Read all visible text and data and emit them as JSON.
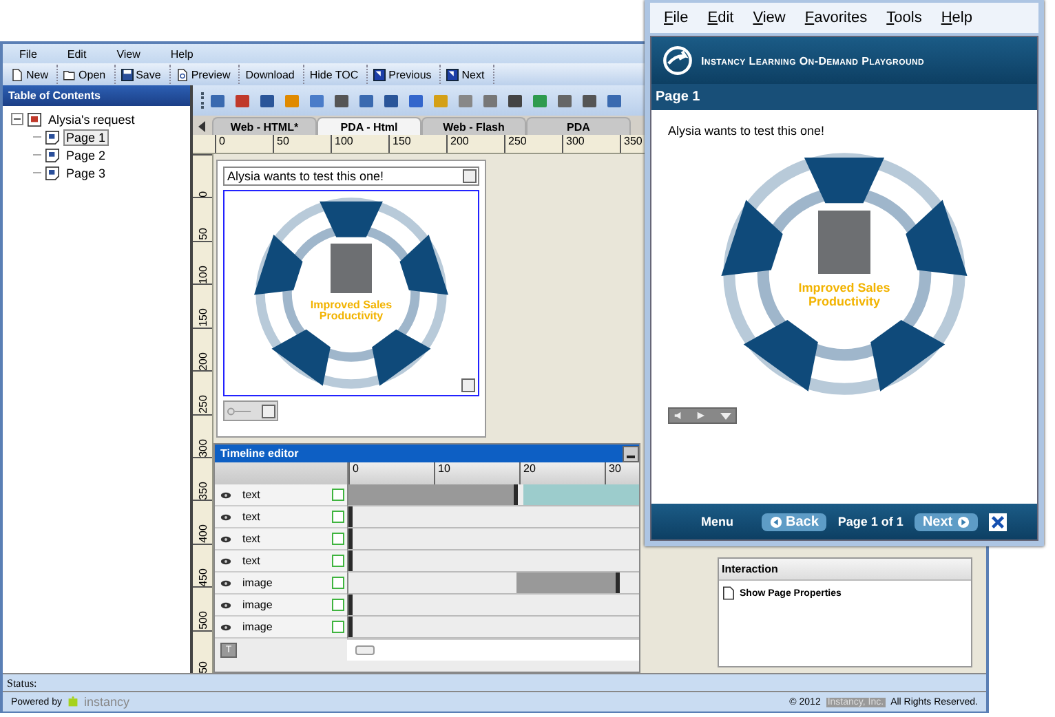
{
  "menu": [
    "File",
    "Edit",
    "View",
    "Help"
  ],
  "toolbar": [
    {
      "label": "New",
      "kind": "new"
    },
    {
      "label": "Open",
      "kind": "open"
    },
    {
      "label": "Save",
      "kind": "save"
    },
    {
      "label": "Preview",
      "kind": "preview"
    },
    {
      "label": "Download",
      "kind": "text"
    },
    {
      "label": "Hide TOC",
      "kind": "text"
    },
    {
      "label": "Previous",
      "kind": "previous"
    },
    {
      "label": "Next",
      "kind": "next"
    }
  ],
  "toc": {
    "title": "Table of Contents",
    "tree": [
      {
        "label": "Alysia's request",
        "expanded": true,
        "selected": false,
        "children": [
          {
            "label": "Page 1",
            "selected": true
          },
          {
            "label": "Page 2",
            "selected": false
          },
          {
            "label": "Page 3",
            "selected": false
          }
        ]
      }
    ]
  },
  "editor": {
    "tabs": [
      {
        "label": "Web - HTML*",
        "selected": false
      },
      {
        "label": "PDA - Html",
        "selected": true
      },
      {
        "label": "Web - Flash",
        "selected": false
      },
      {
        "label": "PDA",
        "selected": false
      }
    ],
    "ruler_h": [
      "0",
      "50",
      "100",
      "150",
      "200",
      "250",
      "300",
      "350"
    ],
    "ruler_v": [
      "0",
      "50",
      "100",
      "150",
      "200",
      "250",
      "300",
      "350",
      "400",
      "450",
      "500",
      "50"
    ],
    "text_box": "Alysia wants to test this one!",
    "diagram": {
      "center_label": "Improved Sales Productivity"
    }
  },
  "timeline": {
    "title": "Timeline editor",
    "ticks": [
      "0",
      "10",
      "20",
      "30"
    ],
    "rows": [
      {
        "label": "text",
        "kind": "long-clip",
        "checked": false
      },
      {
        "label": "text",
        "kind": "start-marker",
        "checked": false
      },
      {
        "label": "text",
        "kind": "start-marker",
        "checked": false
      },
      {
        "label": "text",
        "kind": "start-marker",
        "checked": false
      },
      {
        "label": "image",
        "kind": "late-clip",
        "checked": false
      },
      {
        "label": "image",
        "kind": "start-marker",
        "checked": false
      },
      {
        "label": "image",
        "kind": "start-marker",
        "checked": false
      }
    ],
    "button": "T"
  },
  "interaction": {
    "title": "Interaction",
    "items": [
      "Show Page Properties"
    ]
  },
  "status": "Status:",
  "footer": {
    "powered_by": "Powered by",
    "brand": "instancy",
    "year": "© 2012",
    "company": "Instancy, Inc.",
    "rights": "All Rights Reserved."
  },
  "browser": {
    "menu": [
      "File",
      "Edit",
      "View",
      "Favorites",
      "Tools",
      "Help"
    ],
    "site_title": "Instancy Learning On-Demand Playground",
    "page_title": "Page 1",
    "text": "Alysia wants to test this one!",
    "diagram": {
      "center_label": "Improved Sales Productivity"
    },
    "nav": {
      "menu": "Menu",
      "back": "Back",
      "page_info": "Page 1 of 1",
      "next": "Next"
    }
  }
}
